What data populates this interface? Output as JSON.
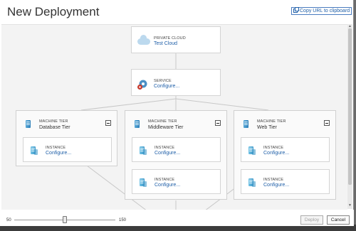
{
  "dialog": {
    "title": "New Deployment",
    "copy_url_label": "Copy URL to clipboard"
  },
  "cloud": {
    "kind": "PRIVATE CLOUD",
    "name": "Test Cloud"
  },
  "service": {
    "kind": "SERVICE",
    "link": "Configure..."
  },
  "tiers": [
    {
      "kind": "MACHINE TIER",
      "name": "Database Tier",
      "instances": [
        {
          "kind": "INSTANCE",
          "link": "Configure..."
        }
      ]
    },
    {
      "kind": "MACHINE TIER",
      "name": "Middleware Tier",
      "instances": [
        {
          "kind": "INSTANCE",
          "link": "Configure..."
        },
        {
          "kind": "INSTANCE",
          "link": "Configure..."
        }
      ]
    },
    {
      "kind": "MACHINE TIER",
      "name": "Web Tier",
      "instances": [
        {
          "kind": "INSTANCE",
          "link": "Configure..."
        },
        {
          "kind": "INSTANCE",
          "link": "Configure..."
        }
      ]
    }
  ],
  "zoom": {
    "min": "50",
    "max": "150",
    "value": 100
  },
  "buttons": {
    "deploy": "Deploy",
    "cancel": "Cancel"
  },
  "colors": {
    "link": "#1f5fa8",
    "canvas": "#f3f3f3",
    "server": "#2e7fb8"
  }
}
